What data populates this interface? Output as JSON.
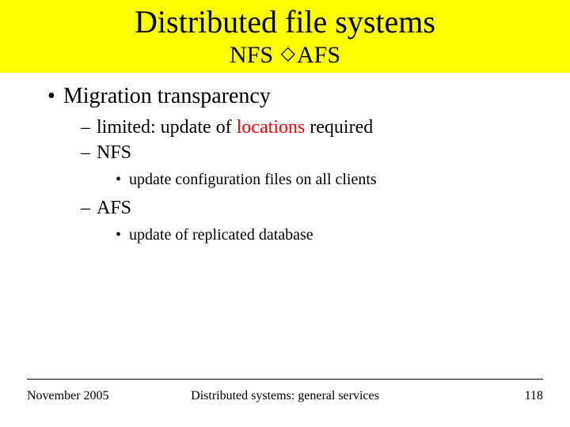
{
  "title": {
    "main": "Distributed file systems",
    "sub_left": "NFS ",
    "sub_right": "AFS"
  },
  "content": {
    "lvl1": "Migration transparency",
    "lvl2a_prefix": "limited: update of ",
    "lvl2a_red": "locations",
    "lvl2a_suffix": " required",
    "lvl2b": "NFS",
    "lvl3a": "update configuration files on all clients",
    "lvl2c": "AFS",
    "lvl3b": "update of replicated database"
  },
  "footer": {
    "date": "November 2005",
    "course": "Distributed systems: general services",
    "page": "118"
  }
}
